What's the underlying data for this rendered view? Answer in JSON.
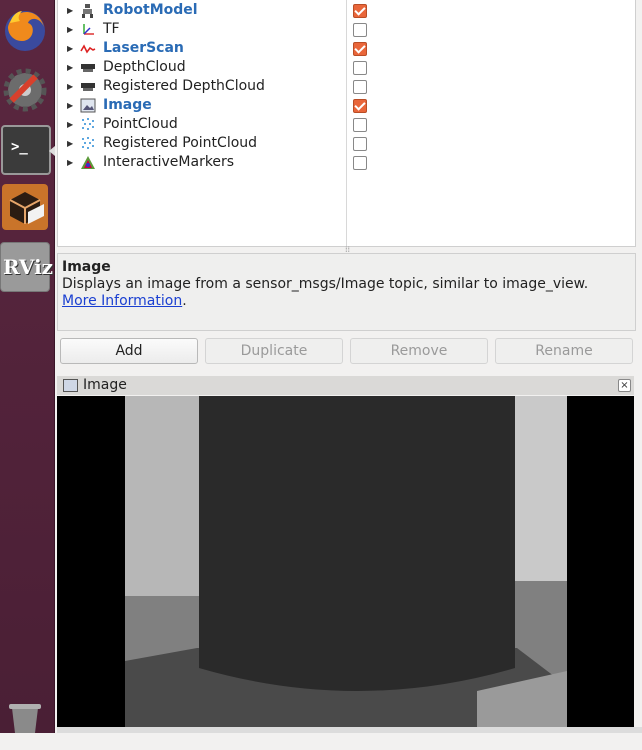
{
  "displays": [
    {
      "label": "RobotModel",
      "checked": true,
      "highlight": true,
      "icon": "robot-model-icon"
    },
    {
      "label": "TF",
      "checked": false,
      "highlight": false,
      "icon": "tf-axes-icon"
    },
    {
      "label": "LaserScan",
      "checked": true,
      "highlight": true,
      "icon": "laser-scan-icon"
    },
    {
      "label": "DepthCloud",
      "checked": false,
      "highlight": false,
      "icon": "depth-cloud-icon"
    },
    {
      "label": "Registered DepthCloud",
      "checked": false,
      "highlight": false,
      "icon": "depth-cloud-icon"
    },
    {
      "label": "Image",
      "checked": true,
      "highlight": true,
      "icon": "image-icon"
    },
    {
      "label": "PointCloud",
      "checked": false,
      "highlight": false,
      "icon": "point-cloud-icon"
    },
    {
      "label": "Registered PointCloud",
      "checked": false,
      "highlight": false,
      "icon": "point-cloud-icon"
    },
    {
      "label": "InteractiveMarkers",
      "checked": false,
      "highlight": false,
      "icon": "interactive-markers-icon"
    }
  ],
  "description": {
    "title": "Image",
    "text": "Displays an image from a sensor_msgs/Image topic, similar to image_view. ",
    "link": "More Information",
    "suffix": "."
  },
  "buttons": {
    "add": "Add",
    "duplicate": "Duplicate",
    "remove": "Remove",
    "rename": "Rename"
  },
  "image_panel": {
    "title": "Image",
    "close": "×"
  },
  "launcher": {
    "items": [
      "firefox-icon",
      "system-settings-icon",
      "terminal-icon",
      "software-box-icon",
      "rviz-icon",
      "trash-icon"
    ],
    "rviz_text": "RViz",
    "terminal_prompt": ">_"
  },
  "colors": {
    "accent_blue": "#2a6bb5",
    "checkbox_orange": "#e9663a",
    "link": "#1a3fd1"
  }
}
